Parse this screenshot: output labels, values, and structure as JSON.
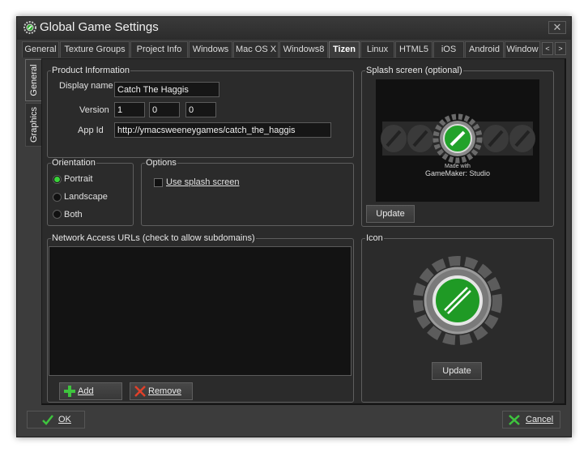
{
  "window": {
    "title": "Global Game Settings",
    "close_label": "✕"
  },
  "tabs": [
    {
      "label": "General"
    },
    {
      "label": "Texture Groups"
    },
    {
      "label": "Project Info"
    },
    {
      "label": "Windows"
    },
    {
      "label": "Mac OS X"
    },
    {
      "label": "Windows8"
    },
    {
      "label": "Tizen"
    },
    {
      "label": "Linux"
    },
    {
      "label": "HTML5"
    },
    {
      "label": "iOS"
    },
    {
      "label": "Android"
    },
    {
      "label": "Window"
    }
  ],
  "active_tab": "Tizen",
  "tab_scroll": {
    "left": "<",
    "right": ">"
  },
  "side_tabs": [
    {
      "label": "General"
    },
    {
      "label": "Graphics"
    }
  ],
  "product_info": {
    "title": "Product Information",
    "display_name_label": "Display name",
    "display_name": "Catch The Haggis",
    "version_label": "Version",
    "version": [
      "1",
      "0",
      "0"
    ],
    "app_id_label": "App Id",
    "app_id": "http://ymacsweeneygames/catch_the_haggis"
  },
  "orientation": {
    "title": "Orientation",
    "options": [
      {
        "label": "Portrait",
        "selected": true
      },
      {
        "label": "Landscape",
        "selected": false
      },
      {
        "label": "Both",
        "selected": false
      }
    ]
  },
  "options": {
    "title": "Options",
    "use_splash_label": "Use splash screen",
    "use_splash_checked": false
  },
  "network": {
    "title": "Network Access URLs (check to allow subdomains)"
  },
  "buttons": {
    "add": "Add",
    "remove": "Remove",
    "ok": "OK",
    "cancel": "Cancel",
    "update": "Update"
  },
  "splash": {
    "title": "Splash screen (optional)",
    "caption_line1": "Made with",
    "caption_line2": "GameMaker: Studio"
  },
  "icon": {
    "title": "Icon"
  },
  "colors": {
    "accent_green": "#2aa12a",
    "background": "#2b2b2b"
  }
}
